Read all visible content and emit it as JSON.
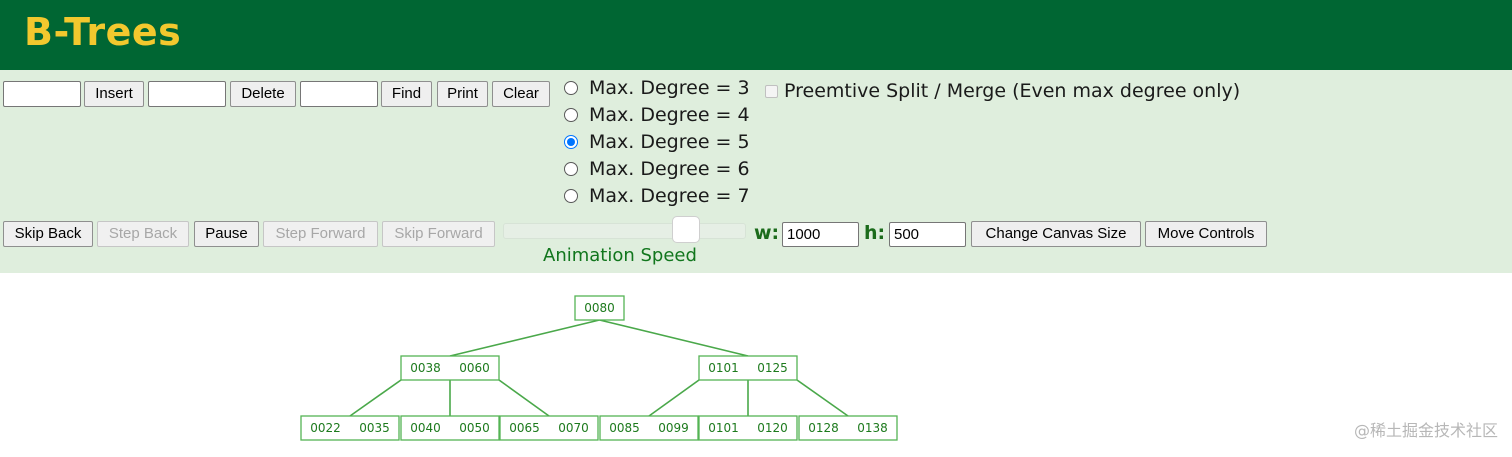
{
  "header": {
    "title": "B-Trees"
  },
  "controls": {
    "insert_value": "",
    "insert_label": "Insert",
    "delete_value": "",
    "delete_label": "Delete",
    "find_value": "",
    "find_label": "Find",
    "print_label": "Print",
    "clear_label": "Clear",
    "degree_options": [
      {
        "label": "Max. Degree = 3",
        "selected": false
      },
      {
        "label": "Max. Degree = 4",
        "selected": false
      },
      {
        "label": "Max. Degree = 5",
        "selected": true
      },
      {
        "label": "Max. Degree = 6",
        "selected": false
      },
      {
        "label": "Max. Degree = 7",
        "selected": false
      }
    ],
    "preemptive_label": "Preemtive Split / Merge (Even max degree only)",
    "preemptive_checked": false,
    "skip_back_label": "Skip Back",
    "step_back_label": "Step Back",
    "pause_label": "Pause",
    "step_forward_label": "Step Forward",
    "skip_forward_label": "Skip Forward",
    "animation_speed_label": "Animation Speed",
    "animation_speed_value": 0.75,
    "width_label": "w:",
    "width_value": "1000",
    "height_label": "h:",
    "height_value": "500",
    "change_canvas_label": "Change Canvas Size",
    "move_controls_label": "Move Controls"
  },
  "tree": {
    "root": [
      "0080"
    ],
    "level1": [
      [
        "0038",
        "0060"
      ],
      [
        "0101",
        "0125"
      ]
    ],
    "leaves": [
      [
        "0022",
        "0035"
      ],
      [
        "0040",
        "0050"
      ],
      [
        "0065",
        "0070"
      ],
      [
        "0085",
        "0099"
      ],
      [
        "0101",
        "0120"
      ],
      [
        "0128",
        "0138"
      ]
    ],
    "colors": {
      "node_border": "#55b455",
      "node_fill": "#ffffff",
      "key_text": "#1d7a1d",
      "edge": "#4aa84a"
    }
  },
  "watermark": "@稀土掘金技术社区"
}
